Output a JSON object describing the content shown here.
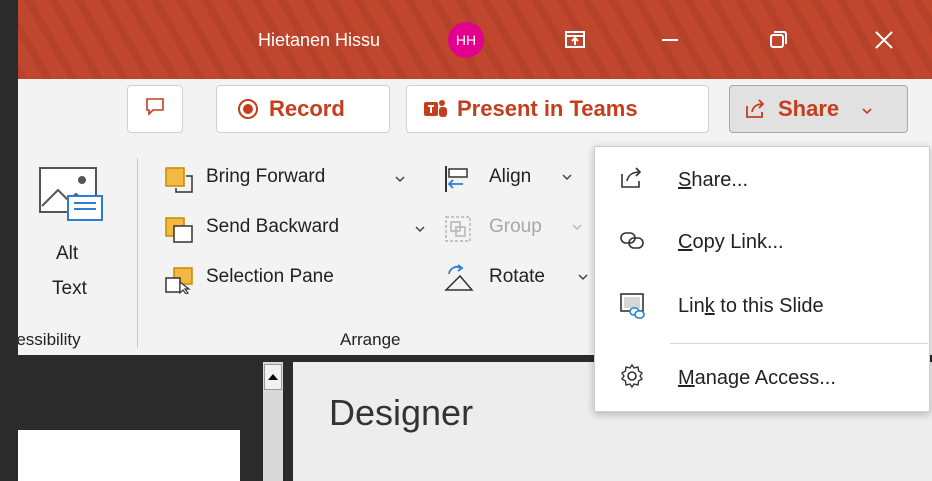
{
  "titlebar": {
    "user_name": "Hietanen Hissu",
    "avatar_initials": "HH",
    "avatar_color": "#e3008c",
    "accent": "#c0462d"
  },
  "actions": {
    "comments_icon": "comment-icon",
    "record_label": "Record",
    "present_teams_label": "Present in Teams",
    "share_label": "Share"
  },
  "ribbon": {
    "accessibility": {
      "alt_text_line1": "Alt",
      "alt_text_line2": "Text",
      "group_label": "Accessibility"
    },
    "arrange": {
      "bring_forward": "Bring Forward",
      "send_backward": "Send Backward",
      "selection_pane": "Selection Pane",
      "align": "Align",
      "group": "Group",
      "rotate": "Rotate",
      "group_label": "Arrange"
    }
  },
  "share_menu": {
    "items": [
      {
        "pre": "",
        "ul": "S",
        "post": "hare...",
        "icon": "share-icon"
      },
      {
        "pre": "",
        "ul": "C",
        "post": "opy Link...",
        "icon": "link-icon"
      },
      {
        "pre": "Lin",
        "ul": "k",
        "post": " to this Slide",
        "icon": "slide-link-icon"
      },
      {
        "pre": "",
        "ul": "M",
        "post": "anage Access...",
        "icon": "gear-icon"
      }
    ]
  },
  "designer": {
    "title": "Designer"
  }
}
